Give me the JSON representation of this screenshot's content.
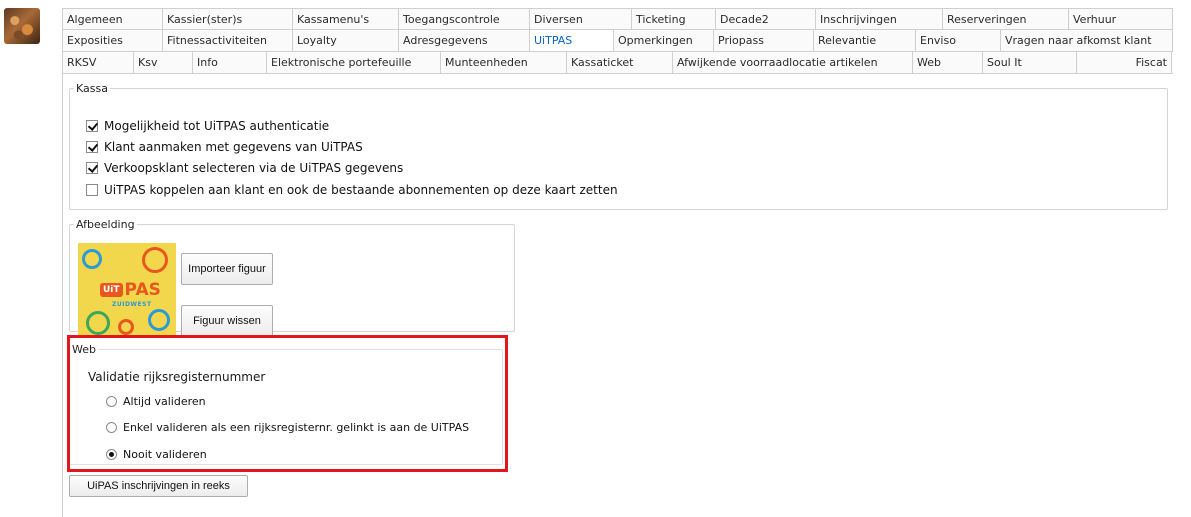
{
  "tabs": {
    "rows": [
      [
        {
          "label": "Algemeen",
          "w": 0
        },
        {
          "label": "Kassier(ster)s"
        },
        {
          "label": "Kassamenu's"
        },
        {
          "label": "Toegangscontrole"
        },
        {
          "label": "Diversen"
        },
        {
          "label": "Ticketing"
        },
        {
          "label": "Decade2"
        },
        {
          "label": "Inschrijvingen"
        },
        {
          "label": "Reserveringen"
        },
        {
          "label": "Verhuur"
        }
      ],
      [
        {
          "label": "Exposities"
        },
        {
          "label": "Fitnessactiviteiten"
        },
        {
          "label": "Loyalty"
        },
        {
          "label": "Adresgegevens"
        },
        {
          "label": "UiTPAS",
          "active": true
        },
        {
          "label": "Opmerkingen"
        },
        {
          "label": "Priopass"
        },
        {
          "label": "Relevantie"
        },
        {
          "label": "Enviso"
        },
        {
          "label": "Vragen naar afkomst klant"
        }
      ],
      [
        {
          "label": "RKSV"
        },
        {
          "label": "Ksv"
        },
        {
          "label": "Info"
        },
        {
          "label": "Elektronische portefeuille"
        },
        {
          "label": "Munteenheden"
        },
        {
          "label": "Kassaticket"
        },
        {
          "label": "Afwijkende voorraadlocatie artikelen"
        },
        {
          "label": "Web"
        },
        {
          "label": "Soul It"
        },
        {
          "label": "Fiscat"
        }
      ]
    ]
  },
  "kassa": {
    "legend": "Kassa",
    "options": [
      {
        "label": "Mogelijkheid tot UiTPAS authenticatie",
        "checked": true
      },
      {
        "label": "Klant aanmaken met gegevens van UiTPAS",
        "checked": true
      },
      {
        "label": "Verkoopsklant selecteren via de UiTPAS gegevens",
        "checked": true
      },
      {
        "label": "UiTPAS koppelen aan klant en ook de bestaande abonnementen op deze kaart zetten",
        "checked": false
      }
    ]
  },
  "afbeelding": {
    "legend": "Afbeelding",
    "logo": {
      "mark_small": "UiT",
      "mark_big": "PAS",
      "sub": "ZUIDWEST"
    },
    "import_label": "Importeer figuur",
    "clear_label": "Figuur wissen"
  },
  "web": {
    "legend": "Web",
    "heading": "Validatie rijksregisternummer",
    "options": [
      {
        "label": "Altijd valideren",
        "selected": false
      },
      {
        "label": "Enkel valideren als een rijksregisternr. gelinkt is aan de UiTPAS",
        "selected": false
      },
      {
        "label": "Nooit valideren",
        "selected": true
      }
    ]
  },
  "bottom_button_label": "UiPAS inschrijvingen in reeks",
  "colors": {
    "active_tab": "#0a64c8",
    "highlight": "#e3161b"
  }
}
